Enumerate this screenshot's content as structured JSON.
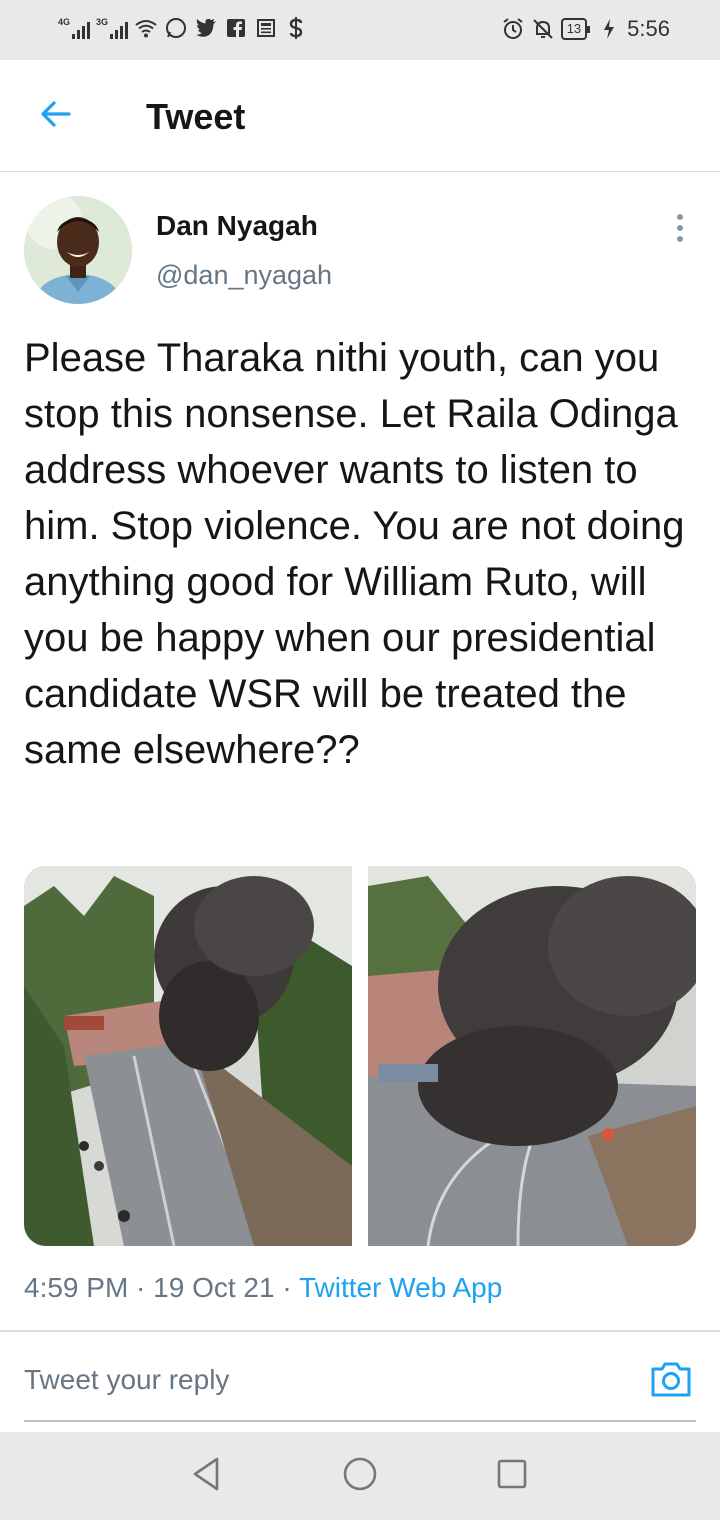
{
  "status_bar": {
    "net1": "4G",
    "net2": "3G",
    "battery": "13",
    "time": "5:56",
    "icons": [
      "signal-icon",
      "wifi-icon",
      "whatsapp-icon",
      "twitter-icon",
      "facebook-icon",
      "news-icon",
      "dollar-icon",
      "alarm-icon",
      "mute-icon",
      "battery-icon",
      "charging-icon"
    ]
  },
  "header": {
    "title": "Tweet",
    "back_icon": "arrow-left-icon"
  },
  "tweet": {
    "author_name": "Dan Nyagah",
    "author_handle": "@dan_nyagah",
    "text": "Please Tharaka nithi youth, can you stop this nonsense. Let Raila Odinga address whoever wants to listen to him. Stop violence. You are not doing anything good for William Ruto, will you be happy when our presidential candidate WSR will be treated the same elsewhere??",
    "time": "4:59 PM",
    "date": "19 Oct 21",
    "separator": " · ",
    "source": "Twitter Web App"
  },
  "reply": {
    "placeholder": "Tweet your reply"
  },
  "colors": {
    "accent": "#1da1f2",
    "text": "#14171a",
    "muted": "#657786",
    "divider": "#d9dde0"
  }
}
